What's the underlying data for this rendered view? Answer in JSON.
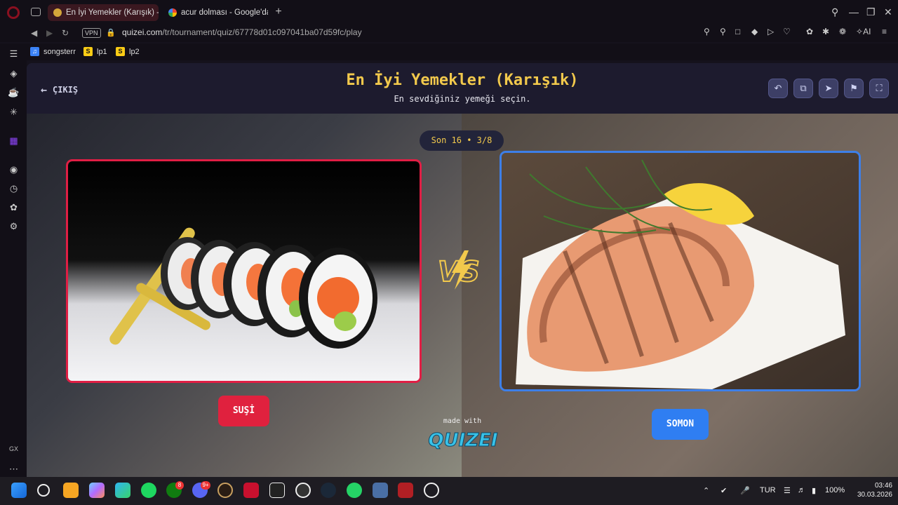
{
  "browser": {
    "tabs": [
      {
        "label": "En İyi Yemekler (Karışık) -",
        "active": true
      },
      {
        "label": "acur dolması - Google'da A",
        "active": false
      }
    ],
    "vpn_label": "VPN",
    "url_domain": "quizei.com",
    "url_path": "/tr/tournament/quiz/67778d01c097041ba07d59fc/play",
    "ai_label": "AI",
    "bookmarks": [
      {
        "label": "songsterr",
        "icon": "songsterr-icon",
        "color": "#3b82f6"
      },
      {
        "label": "lp1",
        "icon": "s-icon",
        "color": "#facc15"
      },
      {
        "label": "lp2",
        "icon": "s-icon",
        "color": "#facc15"
      }
    ],
    "sidebar_gx_label": "GX"
  },
  "quiz": {
    "exit_label": "ÇIKIŞ",
    "title": "En İyi Yemekler (Karışık)",
    "subtitle": "En sevdiğiniz yemeği seçin.",
    "round_label": "Son 16 • 3/8",
    "left_choice": {
      "label": "SUŞİ",
      "image": "sushi-photo",
      "color": "#e0213e"
    },
    "right_choice": {
      "label": "SOMON",
      "image": "salmon-photo",
      "color": "#2f7ef2"
    },
    "vs_label": "VS",
    "made_with_label": "made with",
    "brand_label": "QUIZEI",
    "header_buttons": [
      "undo-icon",
      "share-icon",
      "send-icon",
      "flag-icon",
      "fullscreen-icon"
    ]
  },
  "taskbar": {
    "xbox_badge": "8",
    "discord_badge": "9+",
    "language": "TUR",
    "battery": "100%",
    "time": "03:46",
    "date": "30.03.2026"
  },
  "colors": {
    "accent_yellow": "#f2c94c",
    "header_bg": "#1d1b2e",
    "red": "#e0213e",
    "blue": "#2f7ef2"
  }
}
